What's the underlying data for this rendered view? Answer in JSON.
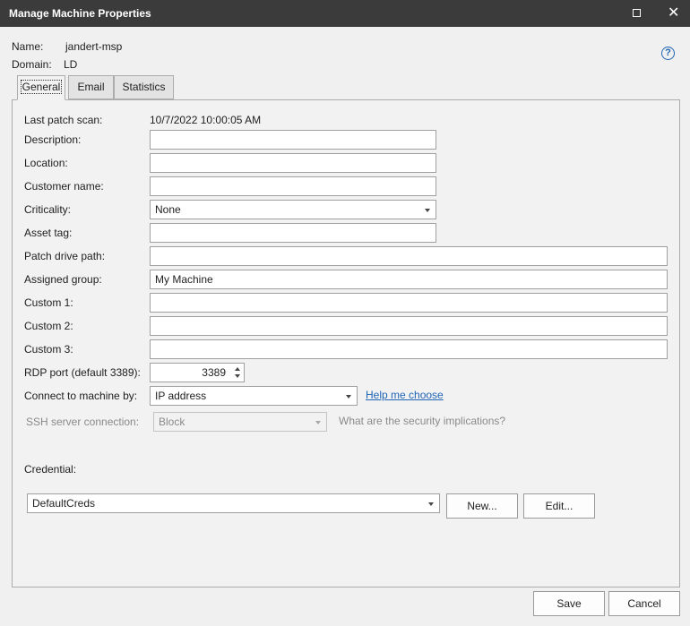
{
  "window": {
    "title": "Manage Machine Properties",
    "maximize_icon": "maximize-icon",
    "close_glyph": "✕"
  },
  "machine": {
    "name_label": "Name:",
    "name_value": "jandert-msp",
    "domain_label": "Domain:",
    "domain_value": "LD"
  },
  "help_glyph": "?",
  "tabs": [
    {
      "label": "General",
      "active": true
    },
    {
      "label": "Email",
      "active": false
    },
    {
      "label": "Statistics",
      "active": false
    }
  ],
  "general": {
    "last_patch_scan_label": "Last patch scan:",
    "last_patch_scan_value": "10/7/2022 10:00:05 AM",
    "description_label": "Description:",
    "description_value": "",
    "location_label": "Location:",
    "location_value": "",
    "customer_name_label": "Customer name:",
    "customer_name_value": "",
    "criticality_label": "Criticality:",
    "criticality_value": "None",
    "asset_tag_label": "Asset tag:",
    "asset_tag_value": "",
    "patch_drive_path_label": "Patch drive path:",
    "patch_drive_path_value": "",
    "assigned_group_label": "Assigned group:",
    "assigned_group_value": "My Machine",
    "custom1_label": "Custom 1:",
    "custom1_value": "",
    "custom2_label": "Custom 2:",
    "custom2_value": "",
    "custom3_label": "Custom 3:",
    "custom3_value": "",
    "rdp_port_label": "RDP port (default 3389):",
    "rdp_port_value": "3389",
    "connect_by_label": "Connect to machine by:",
    "connect_by_value": "IP address",
    "help_me_choose": "Help me choose",
    "ssh_label": "SSH server connection:",
    "ssh_value": "Block",
    "security_note": "What are the security implications?",
    "credential_label": "Credential:",
    "credential_value": "DefaultCreds",
    "new_button": "New...",
    "edit_button": "Edit..."
  },
  "footer": {
    "save": "Save",
    "cancel": "Cancel"
  }
}
